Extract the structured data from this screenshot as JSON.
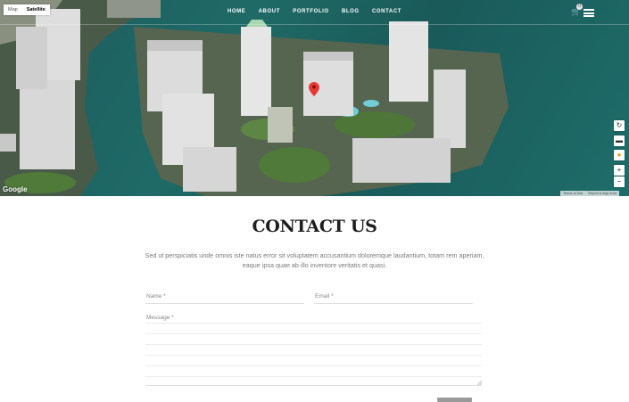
{
  "nav": {
    "items": [
      "HOME",
      "ABOUT",
      "PORTFOLIO",
      "BLOG",
      "CONTACT"
    ],
    "cart_icon": "cart-icon",
    "cart_count": "0",
    "menu_icon": "hamburger-menu-icon"
  },
  "map": {
    "type_map": "Map",
    "type_satellite": "Satellite",
    "logo": "Google",
    "terms": "Terms of Use",
    "report": "Report a map error",
    "zoom_in": "+",
    "zoom_out": "−",
    "pin_color": "#e53935",
    "water_color": "#1c5e5d"
  },
  "contact": {
    "title": "CONTACT US",
    "intro": "Sed ut perspiciatis unde omnis iste natus error sit voluptatem accusantium doloremque laudantium, totam rem aperiam, eaque ipsa quae ab illo inventore veritatis et quasi.",
    "name_label": "Name *",
    "email_label": "Email *",
    "message_label": "Message *"
  }
}
